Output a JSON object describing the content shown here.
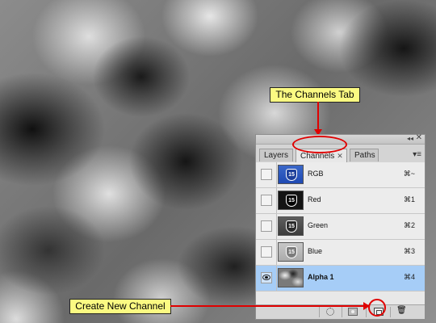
{
  "annotations": {
    "channels_tab_callout": "The Channels Tab",
    "create_channel_callout": "Create New Channel",
    "highlight_color": "#e00000",
    "callout_bg": "#fbfa82"
  },
  "panel": {
    "close_glyph": "✕",
    "collapse_glyph": "◂◂",
    "menu_glyph": "▾≡",
    "tabs": [
      {
        "label": "Layers",
        "active": false
      },
      {
        "label": "Channels",
        "active": true,
        "close": "✕"
      },
      {
        "label": "Paths",
        "active": false
      }
    ],
    "channels": [
      {
        "name": "RGB",
        "shortcut": "⌘~",
        "visible": false,
        "selected": false,
        "thumb_label": "15"
      },
      {
        "name": "Red",
        "shortcut": "⌘1",
        "visible": false,
        "selected": false,
        "thumb_label": "15"
      },
      {
        "name": "Green",
        "shortcut": "⌘2",
        "visible": false,
        "selected": false,
        "thumb_label": "15"
      },
      {
        "name": "Blue",
        "shortcut": "⌘3",
        "visible": false,
        "selected": false,
        "thumb_label": "15"
      },
      {
        "name": "Alpha 1",
        "shortcut": "⌘4",
        "visible": true,
        "selected": true
      }
    ],
    "bottom_icons": [
      "load-selection-icon",
      "save-selection-icon",
      "new-channel-icon",
      "trash-icon"
    ],
    "trash_glyph": "🗑"
  }
}
